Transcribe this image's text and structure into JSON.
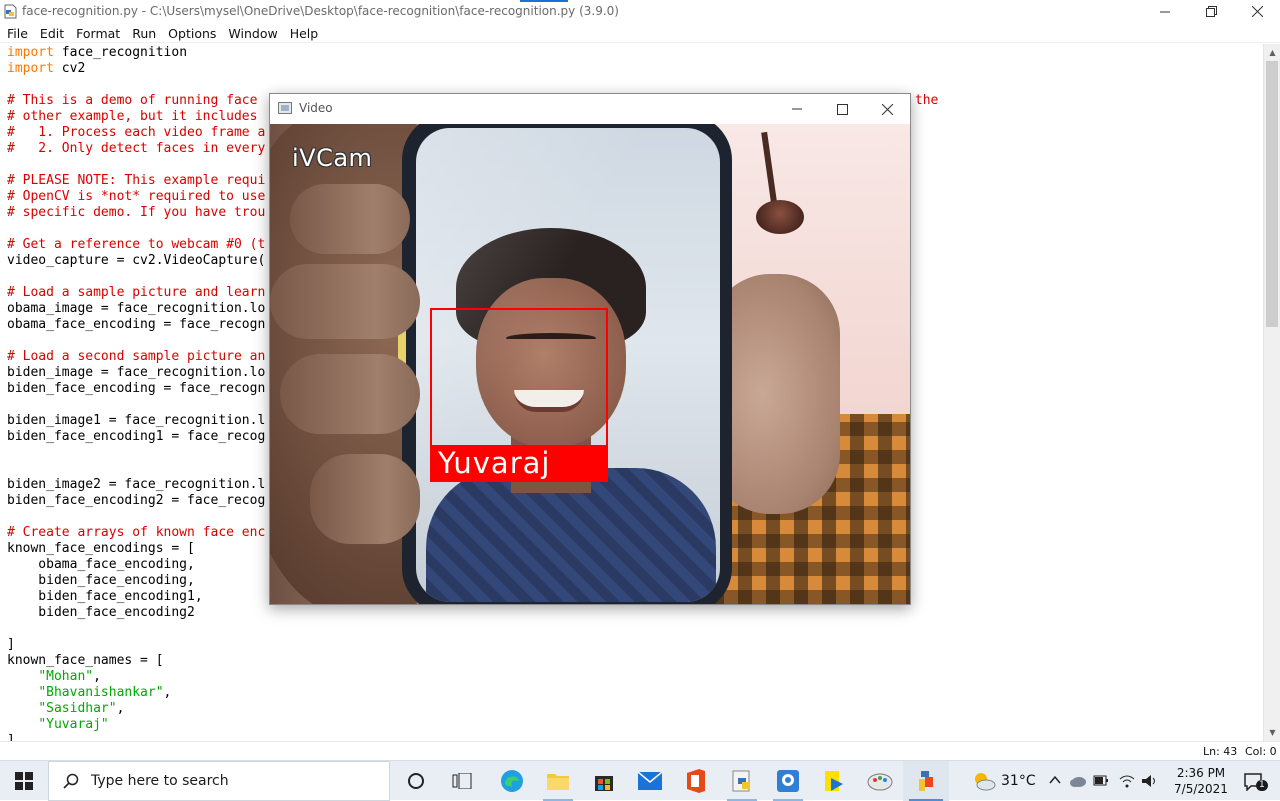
{
  "window": {
    "title": "face-recognition.py - C:\\Users\\mysel\\OneDrive\\Desktop\\face-recognition\\face-recognition.py (3.9.0)"
  },
  "menu": [
    "File",
    "Edit",
    "Format",
    "Run",
    "Options",
    "Window",
    "Help"
  ],
  "code_lines": [
    [
      {
        "t": "import",
        "c": "kw"
      },
      {
        "t": " face_recognition",
        "c": ""
      }
    ],
    [
      {
        "t": "import",
        "c": "kw"
      },
      {
        "t": " cv2",
        "c": ""
      }
    ],
    [],
    [
      {
        "t": "# This is a demo of running face ",
        "c": "cm"
      },
      {
        "t": "                                                                                   the",
        "c": "cm"
      }
    ],
    [
      {
        "t": "# other example, but it includes ",
        "c": "cm"
      }
    ],
    [
      {
        "t": "#   1. Process each video frame a",
        "c": "cm"
      }
    ],
    [
      {
        "t": "#   2. Only detect faces in every",
        "c": "cm"
      }
    ],
    [],
    [
      {
        "t": "# PLEASE NOTE: This example requi",
        "c": "cm"
      }
    ],
    [
      {
        "t": "# OpenCV is *not* required to use",
        "c": "cm"
      }
    ],
    [
      {
        "t": "# specific demo. If you have trou",
        "c": "cm"
      }
    ],
    [],
    [
      {
        "t": "# Get a reference to webcam #0 (t",
        "c": "cm"
      }
    ],
    [
      {
        "t": "video_capture = cv2.VideoCapture(",
        "c": ""
      }
    ],
    [],
    [
      {
        "t": "# Load a sample picture and learn",
        "c": "cm"
      }
    ],
    [
      {
        "t": "obama_image = face_recognition.lo",
        "c": ""
      }
    ],
    [
      {
        "t": "obama_face_encoding = face_recogn",
        "c": ""
      }
    ],
    [],
    [
      {
        "t": "# Load a second sample picture an",
        "c": "cm"
      }
    ],
    [
      {
        "t": "biden_image = face_recognition.lo",
        "c": ""
      }
    ],
    [
      {
        "t": "biden_face_encoding = face_recogn",
        "c": ""
      }
    ],
    [],
    [
      {
        "t": "biden_image1 = face_recognition.l",
        "c": ""
      }
    ],
    [
      {
        "t": "biden_face_encoding1 = face_recog",
        "c": ""
      }
    ],
    [],
    [],
    [
      {
        "t": "biden_image2 = face_recognition.l",
        "c": ""
      }
    ],
    [
      {
        "t": "biden_face_encoding2 = face_recog",
        "c": ""
      }
    ],
    [],
    [
      {
        "t": "# Create arrays of known face enc",
        "c": "cm"
      }
    ],
    [
      {
        "t": "known_face_encodings = [",
        "c": ""
      }
    ],
    [
      {
        "t": "    obama_face_encoding,",
        "c": ""
      }
    ],
    [
      {
        "t": "    biden_face_encoding,",
        "c": ""
      }
    ],
    [
      {
        "t": "    biden_face_encoding1,",
        "c": ""
      }
    ],
    [
      {
        "t": "    biden_face_encoding2",
        "c": ""
      }
    ],
    [],
    [
      {
        "t": "]",
        "c": ""
      }
    ],
    [
      {
        "t": "known_face_names = [",
        "c": ""
      }
    ],
    [
      {
        "t": "    ",
        "c": ""
      },
      {
        "t": "\"Mohan\"",
        "c": "st"
      },
      {
        "t": ",",
        "c": ""
      }
    ],
    [
      {
        "t": "    ",
        "c": ""
      },
      {
        "t": "\"Bhavanishankar\"",
        "c": "st"
      },
      {
        "t": ",",
        "c": ""
      }
    ],
    [
      {
        "t": "    ",
        "c": ""
      },
      {
        "t": "\"Sasidhar\"",
        "c": "st"
      },
      {
        "t": ",",
        "c": ""
      }
    ],
    [
      {
        "t": "    ",
        "c": ""
      },
      {
        "t": "\"Yuvaraj\"",
        "c": "st"
      }
    ],
    [
      {
        "t": "]",
        "c": ""
      }
    ]
  ],
  "status": {
    "line": "Ln: 43",
    "col": "Col: 0"
  },
  "video_window": {
    "title": "Video",
    "watermark": "iVCam",
    "face_label": "Yuvaraj"
  },
  "taskbar": {
    "search_placeholder": "Type here to search",
    "apps": [
      "task-view",
      "edge",
      "file-explorer",
      "store",
      "mail",
      "office",
      "python-idle",
      "webcam-app",
      "sticky-notes",
      "paint",
      "python-app"
    ],
    "temperature": "31°C",
    "time": "2:36 PM",
    "date": "7/5/2021"
  },
  "colors": {
    "keyword": "#ff7700",
    "comment": "#dd0000",
    "string": "#00aa00",
    "face_box": "#ff0000"
  }
}
